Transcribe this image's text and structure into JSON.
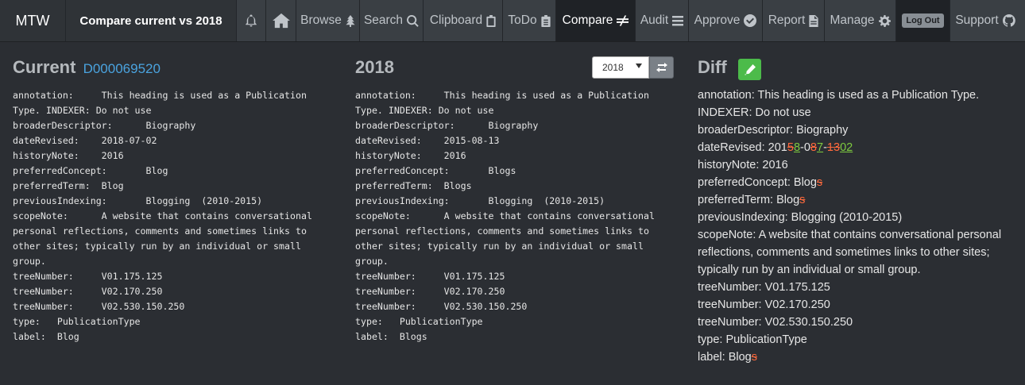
{
  "navbar": {
    "brand": "MTW",
    "page_name": "Compare current vs 2018",
    "items": [
      {
        "label": "Browse",
        "icon": "tree-icon"
      },
      {
        "label": "Search",
        "icon": "search-icon"
      },
      {
        "label": "Clipboard",
        "icon": "clipboard-icon"
      },
      {
        "label": "ToDo",
        "icon": "todo-icon"
      },
      {
        "label": "Compare",
        "icon": "not-equal-icon",
        "active": true
      },
      {
        "label": "Audit",
        "icon": "list-icon"
      },
      {
        "label": "Approve",
        "icon": "check-circle-icon"
      },
      {
        "label": "Report",
        "icon": "file-icon"
      },
      {
        "label": "Manage",
        "icon": "gear-icon"
      }
    ],
    "logout_label": "Log Out",
    "support_label": "Support"
  },
  "current": {
    "title": "Current",
    "id": "D000069520",
    "body": "annotation:     This heading is used as a Publication\nType. INDEXER: Do not use\nbroaderDescriptor:      Biography\ndateRevised:    2018-07-02\nhistoryNote:    2016\npreferredConcept:       Blog\npreferredTerm:  Blog\npreviousIndexing:       Blogging  (2010-2015)\nscopeNote:      A website that contains conversational\npersonal reflections, comments and sometimes links to\nother sites; typically run by an individual or small\ngroup.\ntreeNumber:     V01.175.125\ntreeNumber:     V02.170.250\ntreeNumber:     V02.530.150.250\ntype:   PublicationType\nlabel:  Blog"
  },
  "previous": {
    "title": "2018",
    "selected_year": "2018",
    "body": "annotation:     This heading is used as a Publication\nType. INDEXER: Do not use\nbroaderDescriptor:      Biography\ndateRevised:    2015-08-13\nhistoryNote:    2016\npreferredConcept:       Blogs\npreferredTerm:  Blogs\npreviousIndexing:       Blogging  (2010-2015)\nscopeNote:      A website that contains conversational\npersonal reflections, comments and sometimes links to\nother sites; typically run by an individual or small\ngroup.\ntreeNumber:     V01.175.125\ntreeNumber:     V02.170.250\ntreeNumber:     V02.530.150.250\ntype:   PublicationType\nlabel:  Blogs"
  },
  "diff": {
    "title": "Diff",
    "lines": [
      {
        "text": "annotation: This heading is used as a Publication Type. INDEXER: Do not use"
      },
      {
        "text": "broaderDescriptor: Biography"
      },
      {
        "parts": [
          {
            "t": "dateRevised: 201"
          },
          {
            "t": "5",
            "k": "del"
          },
          {
            "t": "8",
            "k": "ins"
          },
          {
            "t": "-0"
          },
          {
            "t": "8",
            "k": "del"
          },
          {
            "t": "7",
            "k": "ins"
          },
          {
            "t": "-"
          },
          {
            "t": "13",
            "k": "del"
          },
          {
            "t": "02",
            "k": "ins"
          }
        ]
      },
      {
        "text": "historyNote: 2016"
      },
      {
        "parts": [
          {
            "t": "preferredConcept: Blog"
          },
          {
            "t": "s",
            "k": "del"
          }
        ]
      },
      {
        "parts": [
          {
            "t": "preferredTerm: Blog"
          },
          {
            "t": "s",
            "k": "del"
          }
        ]
      },
      {
        "text": "previousIndexing: Blogging (2010-2015)"
      },
      {
        "text": "scopeNote: A website that contains conversational personal reflections, comments and sometimes links to other sites; typically run by an individual or small group."
      },
      {
        "text": "treeNumber: V01.175.125"
      },
      {
        "text": "treeNumber: V02.170.250"
      },
      {
        "text": "treeNumber: V02.530.150.250"
      },
      {
        "text": "type: PublicationType"
      },
      {
        "parts": [
          {
            "t": "label: Blog"
          },
          {
            "t": "s",
            "k": "del"
          }
        ]
      }
    ]
  },
  "colors": {
    "accent_link": "#4aa3df",
    "edit_button": "#4cbb4a",
    "deleted": "#ff6a3d",
    "inserted": "#7ecb3f"
  }
}
